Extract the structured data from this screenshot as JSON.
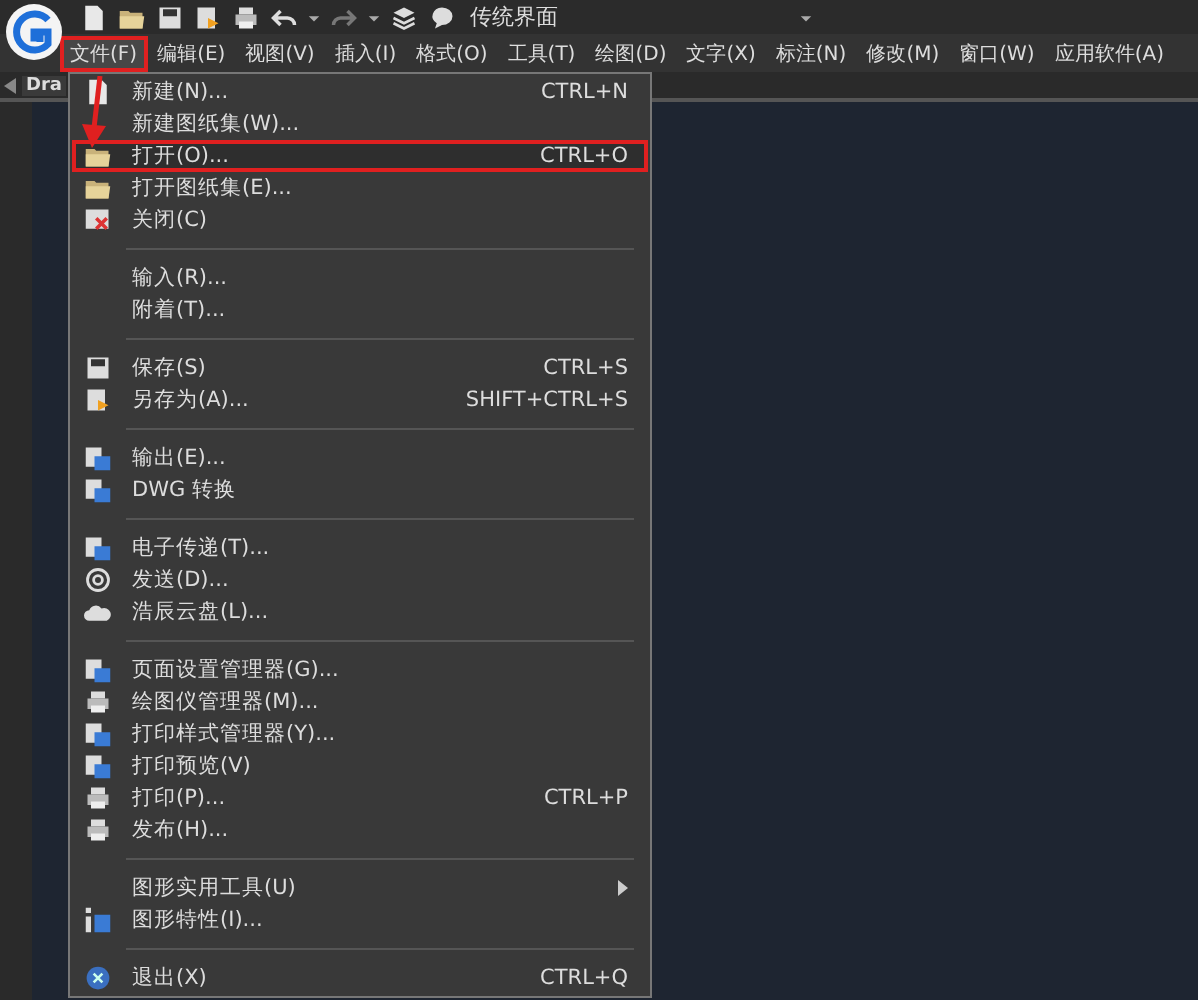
{
  "quick_access": {
    "workspace": "传统界面"
  },
  "menubar": [
    {
      "label": "文件(F)",
      "highlighted": true
    },
    {
      "label": "编辑(E)",
      "highlighted": false
    },
    {
      "label": "视图(V)",
      "highlighted": false
    },
    {
      "label": "插入(I)",
      "highlighted": false
    },
    {
      "label": "格式(O)",
      "highlighted": false
    },
    {
      "label": "工具(T)",
      "highlighted": false
    },
    {
      "label": "绘图(D)",
      "highlighted": false
    },
    {
      "label": "文字(X)",
      "highlighted": false
    },
    {
      "label": "标注(N)",
      "highlighted": false
    },
    {
      "label": "修改(M)",
      "highlighted": false
    },
    {
      "label": "窗口(W)",
      "highlighted": false
    },
    {
      "label": "应用软件(A)",
      "highlighted": false
    }
  ],
  "tabs": [
    {
      "label": "Dra"
    }
  ],
  "file_menu": {
    "groups": [
      [
        {
          "label": "新建(N)...",
          "shortcut": "CTRL+N",
          "highlighted": false
        },
        {
          "label": "新建图纸集(W)...",
          "highlighted": false
        },
        {
          "label": "打开(O)...",
          "shortcut": "CTRL+O",
          "highlighted": true
        },
        {
          "label": "打开图纸集(E)...",
          "highlighted": false
        },
        {
          "label": "关闭(C)",
          "highlighted": false
        }
      ],
      [
        {
          "label": "输入(R)...",
          "highlighted": false
        },
        {
          "label": "附着(T)...",
          "highlighted": false
        }
      ],
      [
        {
          "label": "保存(S)",
          "shortcut": "CTRL+S",
          "highlighted": false
        },
        {
          "label": "另存为(A)...",
          "shortcut": "SHIFT+CTRL+S",
          "highlighted": false
        }
      ],
      [
        {
          "label": "输出(E)...",
          "highlighted": false
        },
        {
          "label": "DWG 转换",
          "highlighted": false
        }
      ],
      [
        {
          "label": "电子传递(T)...",
          "highlighted": false
        },
        {
          "label": "发送(D)...",
          "highlighted": false
        },
        {
          "label": "浩辰云盘(L)...",
          "highlighted": false
        }
      ],
      [
        {
          "label": "页面设置管理器(G)...",
          "highlighted": false
        },
        {
          "label": "绘图仪管理器(M)...",
          "highlighted": false
        },
        {
          "label": "打印样式管理器(Y)...",
          "highlighted": false
        },
        {
          "label": "打印预览(V)",
          "highlighted": false
        },
        {
          "label": "打印(P)...",
          "shortcut": "CTRL+P",
          "highlighted": false
        },
        {
          "label": "发布(H)...",
          "highlighted": false
        }
      ],
      [
        {
          "label": "图形实用工具(U)",
          "submenu": true,
          "highlighted": false
        },
        {
          "label": "图形特性(I)...",
          "highlighted": false
        }
      ],
      [
        {
          "label": "退出(X)",
          "shortcut": "CTRL+Q",
          "highlighted": false
        }
      ]
    ]
  }
}
